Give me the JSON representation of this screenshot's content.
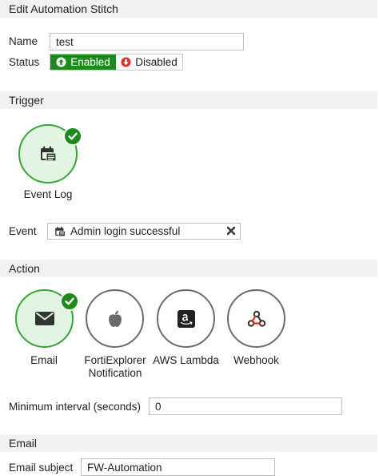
{
  "header": {
    "title": "Edit Automation Stitch"
  },
  "form": {
    "name_label": "Name",
    "name_value": "test",
    "status_label": "Status",
    "status_enabled": "Enabled",
    "status_disabled": "Disabled",
    "status_selected": "Enabled"
  },
  "trigger": {
    "section_title": "Trigger",
    "tile_label": "Event Log",
    "tile_icon": "calendar-list-icon",
    "selected": true,
    "event_label": "Event",
    "event_value": "Admin login successful"
  },
  "action": {
    "section_title": "Action",
    "items": [
      {
        "label": "Email",
        "icon": "envelope-icon",
        "selected": true
      },
      {
        "label_line1": "FortiExplorer",
        "label_line2": "Notification",
        "icon": "apple-icon",
        "selected": false
      },
      {
        "label": "AWS Lambda",
        "icon": "amazon-icon",
        "selected": false
      },
      {
        "label": "Webhook",
        "icon": "webhook-icon",
        "selected": false
      }
    ],
    "interval_label": "Minimum interval (seconds)",
    "interval_value": "0"
  },
  "email": {
    "section_title": "Email",
    "subject_label": "Email subject",
    "subject_value": "FW-Automation"
  },
  "colors": {
    "accent_green": "#1e8a1e",
    "selected_fill": "#e2f5e2",
    "disabled_red": "#d9302c",
    "section_bg": "#f1f1f1"
  }
}
